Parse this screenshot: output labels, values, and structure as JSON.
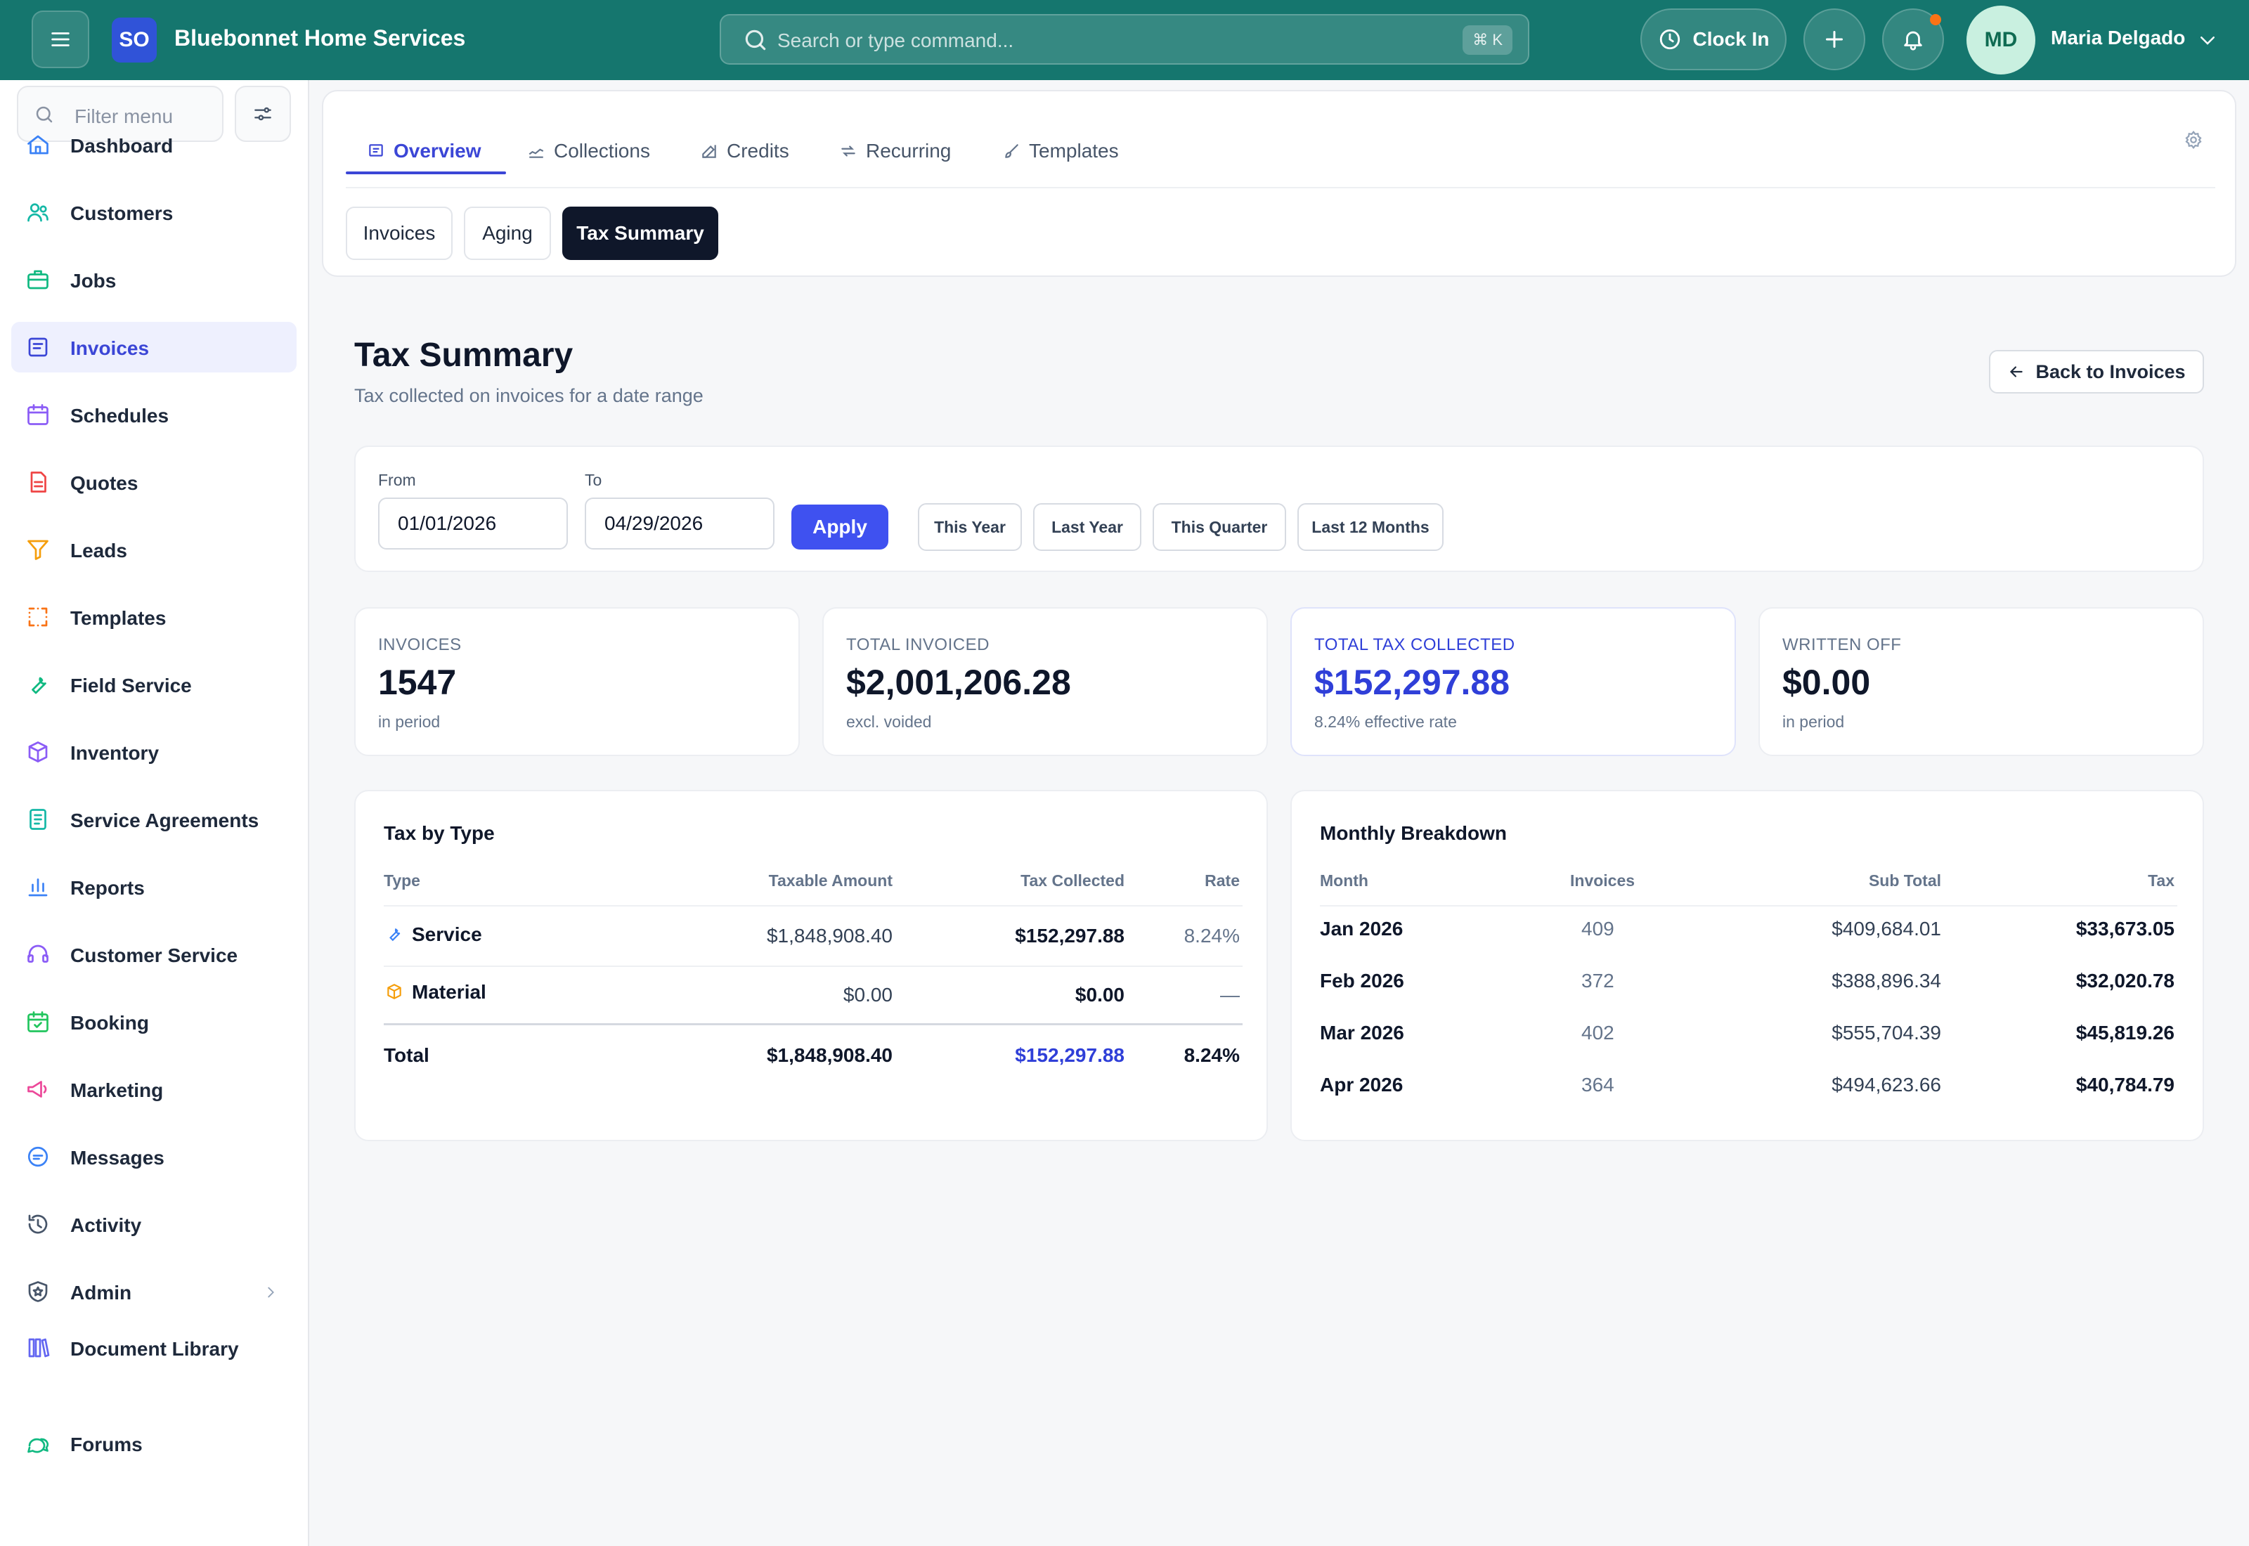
{
  "app": {
    "logo_badge": "SO",
    "name": "Bluebonnet Home Services",
    "search_placeholder": "Search or type command...",
    "search_shortcut": "⌘ K",
    "clock_in_label": "Clock In",
    "user_initials": "MD",
    "user_name": "Maria Delgado",
    "accent_color": "#15766e"
  },
  "sidebar": {
    "filter_placeholder": "Filter menu",
    "items": [
      {
        "label": "Dashboard",
        "icon": "home-icon"
      },
      {
        "label": "Customers",
        "icon": "users-icon"
      },
      {
        "label": "Jobs",
        "icon": "briefcase-icon"
      },
      {
        "label": "Invoices",
        "icon": "invoice-icon",
        "active": true
      },
      {
        "label": "Schedules",
        "icon": "calendar-icon"
      },
      {
        "label": "Quotes",
        "icon": "document-icon"
      },
      {
        "label": "Leads",
        "icon": "funnel-icon"
      },
      {
        "label": "Templates",
        "icon": "template-icon"
      },
      {
        "label": "Field Service",
        "icon": "wrench-icon"
      },
      {
        "label": "Inventory",
        "icon": "box-icon"
      },
      {
        "label": "Service Agreements",
        "icon": "agreement-icon"
      },
      {
        "label": "Reports",
        "icon": "bar-chart-icon"
      },
      {
        "label": "Customer Service",
        "icon": "headset-icon"
      },
      {
        "label": "Booking",
        "icon": "calendar-check-icon"
      },
      {
        "label": "Marketing",
        "icon": "megaphone-icon"
      },
      {
        "label": "Messages",
        "icon": "chat-icon"
      },
      {
        "label": "Activity",
        "icon": "history-icon"
      },
      {
        "label": "Admin",
        "icon": "shield-icon"
      },
      {
        "label": "Document Library",
        "icon": "library-icon"
      },
      {
        "label": "Forums",
        "icon": "forum-icon"
      }
    ]
  },
  "tabs": [
    {
      "label": "Overview",
      "icon": "overview-icon",
      "active": true
    },
    {
      "label": "Collections",
      "icon": "collections-icon"
    },
    {
      "label": "Credits",
      "icon": "edit-icon"
    },
    {
      "label": "Recurring",
      "icon": "repeat-icon"
    },
    {
      "label": "Templates",
      "icon": "brush-icon"
    }
  ],
  "subtabs": [
    {
      "label": "Invoices"
    },
    {
      "label": "Aging"
    },
    {
      "label": "Tax Summary",
      "active": true
    }
  ],
  "page": {
    "title": "Tax Summary",
    "subtitle": "Tax collected on invoices for a date range",
    "back_label": "Back to Invoices"
  },
  "filters": {
    "from_label": "From",
    "from_value": "01/01/2026",
    "to_label": "To",
    "to_value": "04/29/2026",
    "apply_label": "Apply",
    "presets": [
      "This Year",
      "Last Year",
      "This Quarter",
      "Last 12 Months"
    ]
  },
  "stats": [
    {
      "label": "INVOICES",
      "value": "1547",
      "note": "in period"
    },
    {
      "label": "TOTAL INVOICED",
      "value": "$2,001,206.28",
      "note": "excl. voided"
    },
    {
      "label": "TOTAL TAX COLLECTED",
      "value": "$152,297.88",
      "note": "8.24% effective rate",
      "accent": true
    },
    {
      "label": "WRITTEN OFF",
      "value": "$0.00",
      "note": "in period"
    }
  ],
  "tax_by_type": {
    "title": "Tax by Type",
    "headers": [
      "Type",
      "Taxable Amount",
      "Tax Collected",
      "Rate"
    ],
    "rows": [
      {
        "type": "Service",
        "icon": "wrench-icon",
        "taxable": "$1,848,908.40",
        "tax": "$152,297.88",
        "rate": "8.24%"
      },
      {
        "type": "Material",
        "icon": "box-icon",
        "taxable": "$0.00",
        "tax": "$0.00",
        "rate": "—"
      }
    ],
    "total": {
      "type": "Total",
      "taxable": "$1,848,908.40",
      "tax": "$152,297.88",
      "rate": "8.24%"
    }
  },
  "monthly": {
    "title": "Monthly Breakdown",
    "headers": [
      "Month",
      "Invoices",
      "Sub Total",
      "Tax"
    ],
    "rows": [
      {
        "month": "Jan 2026",
        "invoices": "409",
        "subtotal": "$409,684.01",
        "tax": "$33,673.05"
      },
      {
        "month": "Feb 2026",
        "invoices": "372",
        "subtotal": "$388,896.34",
        "tax": "$32,020.78"
      },
      {
        "month": "Mar 2026",
        "invoices": "402",
        "subtotal": "$555,704.39",
        "tax": "$45,819.26"
      },
      {
        "month": "Apr 2026",
        "invoices": "364",
        "subtotal": "$494,623.66",
        "tax": "$40,784.79"
      }
    ]
  }
}
